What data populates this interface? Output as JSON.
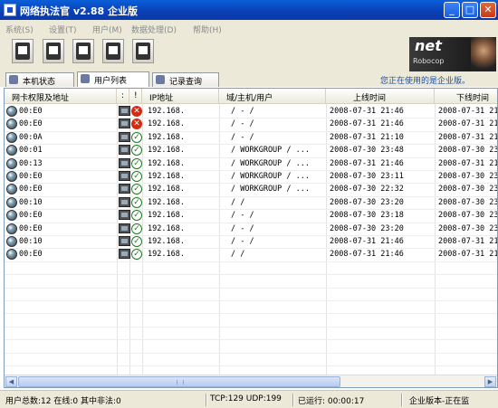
{
  "window": {
    "title": "网络执法官  v2.88  企业版",
    "min_glyph": "_",
    "max_glyph": "□",
    "close_glyph": "✕"
  },
  "menu": [
    {
      "label": "系统(S)"
    },
    {
      "label": "设置(T)"
    },
    {
      "label": "用户(M)"
    },
    {
      "label": "数据处理(D)"
    },
    {
      "label": "帮助(H)"
    }
  ],
  "toolbar": {
    "buttons": [
      {
        "icon": "system-icon"
      },
      {
        "icon": "settings-icon"
      },
      {
        "icon": "key-icon"
      },
      {
        "icon": "monitor-icon"
      },
      {
        "icon": "help-icon"
      }
    ]
  },
  "logo": {
    "line1": "net",
    "line2": "Robocop"
  },
  "tabs": [
    {
      "label": "本机状态",
      "active": false
    },
    {
      "label": "用户列表",
      "active": true
    },
    {
      "label": "记录查询",
      "active": false
    }
  ],
  "notice": "您正在使用的是企业版。",
  "table": {
    "headers": [
      "网卡权限及地址",
      ":",
      "!",
      "IP地址",
      "域/主机/用户",
      "上线时间",
      "下线时间"
    ],
    "rows": [
      {
        "mac": "00:E0",
        "status": "x",
        "ip": "192.168.",
        "host": "/ - /",
        "online": "2008-07-31 21:46",
        "offline": "2008-07-31 21"
      },
      {
        "mac": "00:E0",
        "status": "x",
        "ip": "192.168.",
        "host": "/ - /",
        "online": "2008-07-31 21:46",
        "offline": "2008-07-31 21"
      },
      {
        "mac": "00:0A",
        "status": "ok",
        "ip": "192.168.",
        "host": "/ - /",
        "online": "2008-07-31 21:10",
        "offline": "2008-07-31 21"
      },
      {
        "mac": "00:01",
        "status": "ok",
        "ip": "192.168.",
        "host": "/ WORKGROUP / ...",
        "online": "2008-07-30 23:48",
        "offline": "2008-07-30 23"
      },
      {
        "mac": "00:13",
        "status": "ok",
        "ip": "192.168.",
        "host": "/ WORKGROUP / ...",
        "online": "2008-07-31 21:46",
        "offline": "2008-07-31 21"
      },
      {
        "mac": "00:E0",
        "status": "ok",
        "ip": "192.168.",
        "host": "/ WORKGROUP / ...",
        "online": "2008-07-30 23:11",
        "offline": "2008-07-30 23"
      },
      {
        "mac": "00:E0",
        "status": "ok",
        "ip": "192.168.",
        "host": "/ WORKGROUP / ...",
        "online": "2008-07-30 22:32",
        "offline": "2008-07-30 23"
      },
      {
        "mac": "00:10",
        "status": "ok",
        "ip": "192.168.",
        "host": "/  /",
        "online": "2008-07-30 23:20",
        "offline": "2008-07-30 23"
      },
      {
        "mac": "00:E0",
        "status": "ok",
        "ip": "192.168.",
        "host": "/ - /",
        "online": "2008-07-30 23:18",
        "offline": "2008-07-30 23"
      },
      {
        "mac": "00:E0",
        "status": "ok",
        "ip": "192.168.",
        "host": "/ - /",
        "online": "2008-07-30 23:20",
        "offline": "2008-07-30 23"
      },
      {
        "mac": "00:10",
        "status": "ok",
        "ip": "192.168.",
        "host": "/ - /",
        "online": "2008-07-31 21:46",
        "offline": "2008-07-31 21"
      },
      {
        "mac": "00:E0",
        "status": "ok",
        "ip": "192.168.",
        "host": "/  /",
        "online": "2008-07-31 21:46",
        "offline": "2008-07-31 21"
      }
    ]
  },
  "statusbar": {
    "users": "用户总数:12 在线:0 其中非法:0",
    "traffic": "TCP:129 UDP:199",
    "uptime": "已运行: 00:00:17",
    "mode": "企业版本-正在监"
  },
  "colors": {
    "titlebar": "#0b3fb5",
    "face": "#ece9d8",
    "status_bad": "#d42a12",
    "status_ok": "#1f7a1f",
    "notice": "#2050a0"
  }
}
